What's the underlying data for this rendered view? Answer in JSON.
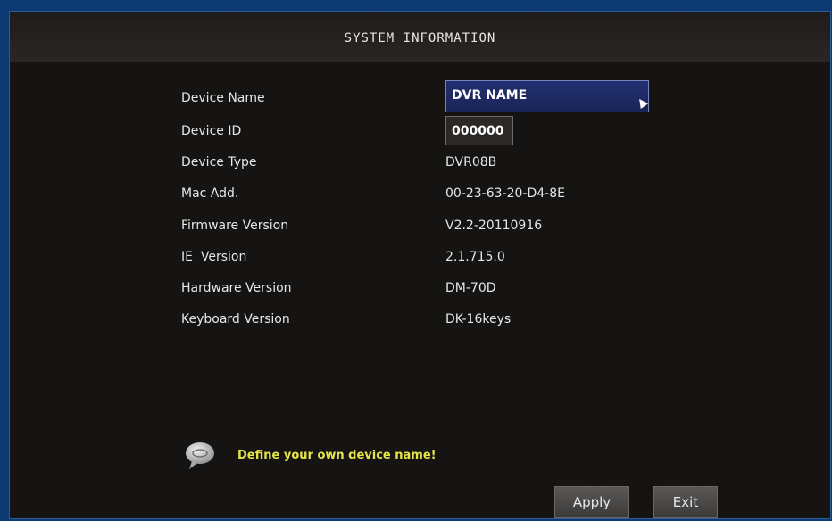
{
  "window": {
    "title": "SYSTEM INFORMATION"
  },
  "info": {
    "device_name": {
      "label": "Device Name",
      "value": "DVR NAME"
    },
    "device_id": {
      "label": "Device ID",
      "value": "000000"
    },
    "device_type": {
      "label": "Device Type",
      "value": "DVR08B"
    },
    "mac_add": {
      "label": "Mac Add.",
      "value": "00-23-63-20-D4-8E"
    },
    "firmware_version": {
      "label": "Firmware Version",
      "value": "V2.2-20110916"
    },
    "ie_version": {
      "label": "IE  Version",
      "value": "2.1.715.0"
    },
    "hardware_version": {
      "label": "Hardware Version",
      "value": "DM-70D"
    },
    "keyboard_version": {
      "label": "Keyboard Version",
      "value": "DK-16keys"
    }
  },
  "hint": {
    "icon": "speech-bubble-icon",
    "text": "Define your own device name!"
  },
  "buttons": {
    "apply": "Apply",
    "exit": "Exit"
  },
  "colors": {
    "accent": "#1a2556",
    "hint": "#e5e54a",
    "frame": "#0d3a73"
  }
}
